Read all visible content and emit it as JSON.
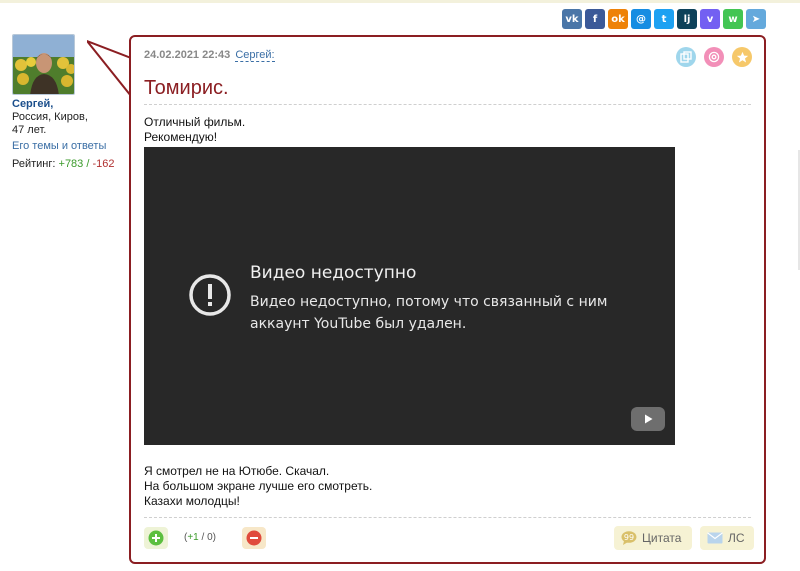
{
  "share": [
    {
      "icon": "vk-icon",
      "glyph": "vk",
      "color": "#4a76a8"
    },
    {
      "icon": "facebook-icon",
      "glyph": "f",
      "color": "#3b5998"
    },
    {
      "icon": "odnoklassniki-icon",
      "glyph": "ok",
      "color": "#ee8208"
    },
    {
      "icon": "moimir-icon",
      "glyph": "@",
      "color": "#168de2"
    },
    {
      "icon": "twitter-icon",
      "glyph": "t",
      "color": "#1da1f2"
    },
    {
      "icon": "livejournal-icon",
      "glyph": "lj",
      "color": "#0d425a"
    },
    {
      "icon": "viber-icon",
      "glyph": "v",
      "color": "#7360f2"
    },
    {
      "icon": "whatsapp-icon",
      "glyph": "w",
      "color": "#43c553"
    },
    {
      "icon": "telegram-icon",
      "glyph": "➤",
      "color": "#64a9dc"
    }
  ],
  "author": {
    "name": "Сергей,",
    "location": "Россия, Киров,",
    "age": "47 лет.",
    "topics_link": "Его темы и ответы",
    "rating_label": "Рейтинг:",
    "rating_pos": "+783",
    "rating_sep": "/",
    "rating_neg": "-162"
  },
  "post": {
    "datetime": "24.02.2021 22:43",
    "author_link": "Сергей:",
    "title": "Томирис.",
    "intro_lines": [
      "Отличный фильм.",
      "Рекомендую!"
    ],
    "outro_lines": [
      "Я смотрел не на Ютюбе. Скачал.",
      "На большом экране лучше его смотреть.",
      "Казахи молодцы!"
    ]
  },
  "video": {
    "title": "Видео недоступно",
    "message": "Видео недоступно, потому что связанный с ним аккаунт YouTube был удален."
  },
  "footer": {
    "score_open": "(",
    "score_pos": "+1",
    "score_sep": " / ",
    "score_neg": "0",
    "score_close": ")",
    "quote_label": "Цитата",
    "pm_label": "ЛС"
  },
  "colors": {
    "accent": "#8b1e22",
    "link": "#3a6ea5",
    "positive": "#3a9a2a",
    "negative": "#b03030"
  }
}
